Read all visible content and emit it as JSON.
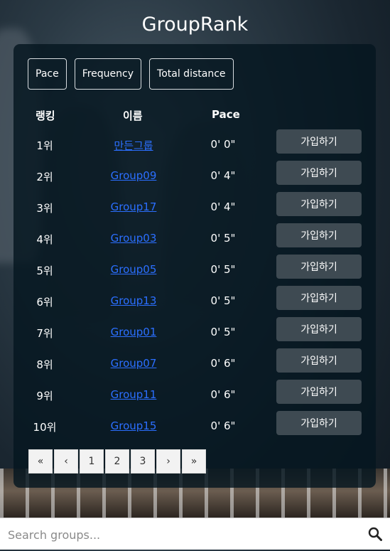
{
  "app": {
    "title": "GroupRank"
  },
  "sort_tabs": [
    "Pace",
    "Frequency",
    "Total distance"
  ],
  "table": {
    "headers": {
      "rank": "랭킹",
      "name": "이름",
      "pace": "Pace"
    },
    "rows": [
      {
        "rank": "1위",
        "name": "만든그룹",
        "pace": "0' 0\"",
        "action": "가입하기"
      },
      {
        "rank": "2위",
        "name": "Group09",
        "pace": "0' 4\"",
        "action": "가입하기"
      },
      {
        "rank": "3위",
        "name": "Group17",
        "pace": "0' 4\"",
        "action": "가입하기"
      },
      {
        "rank": "4위",
        "name": "Group03",
        "pace": "0' 5\"",
        "action": "가입하기"
      },
      {
        "rank": "5위",
        "name": "Group05",
        "pace": "0' 5\"",
        "action": "가입하기"
      },
      {
        "rank": "6위",
        "name": "Group13",
        "pace": "0' 5\"",
        "action": "가입하기"
      },
      {
        "rank": "7위",
        "name": "Group01",
        "pace": "0' 5\"",
        "action": "가입하기"
      },
      {
        "rank": "8위",
        "name": "Group07",
        "pace": "0' 6\"",
        "action": "가입하기"
      },
      {
        "rank": "9위",
        "name": "Group11",
        "pace": "0' 6\"",
        "action": "가입하기"
      },
      {
        "rank": "10위",
        "name": "Group15",
        "pace": "0' 6\"",
        "action": "가입하기"
      }
    ]
  },
  "pagination": {
    "first": "«",
    "prev": "‹",
    "pages": [
      "1",
      "2",
      "3"
    ],
    "next": "›",
    "last": "»"
  },
  "search": {
    "placeholder": "Search groups...",
    "icon": "search-icon"
  },
  "colors": {
    "link": "#2b6fff",
    "panel": "#051620",
    "join_button": "#3e4a52"
  }
}
